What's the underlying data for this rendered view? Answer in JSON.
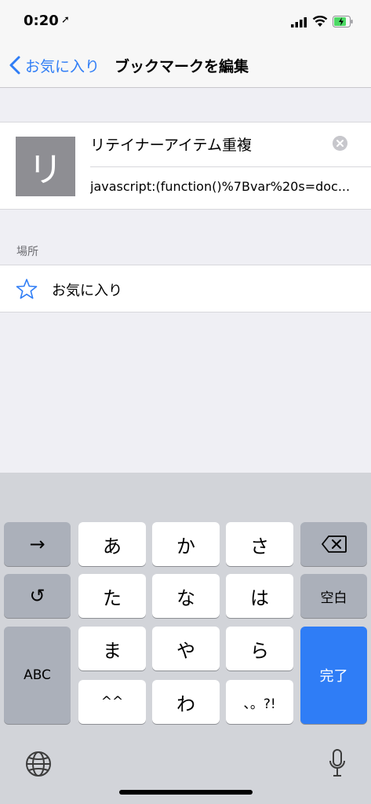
{
  "status": {
    "time": "0:20",
    "icons": [
      "location-arrow-icon",
      "signal-icon",
      "wifi-icon",
      "battery-charging-icon"
    ]
  },
  "nav": {
    "back_label": "お気に入り",
    "title": "ブックマークを編集"
  },
  "bookmark": {
    "thumb_letter": "リ",
    "title_value": "リテイナーアイテム重複",
    "url_value": "javascript:(function()%7Bvar%20s=doc..."
  },
  "location": {
    "section_label": "場所",
    "folder": "お気に入り"
  },
  "keyboard": {
    "keys": {
      "arrow": "→",
      "a": "あ",
      "ka": "か",
      "sa": "さ",
      "undo": "↺",
      "ta": "た",
      "na": "な",
      "ha": "は",
      "space": "空白",
      "abc": "ABC",
      "ma": "ま",
      "ya": "や",
      "ra": "ら",
      "done": "完了",
      "kaomoji": "^^",
      "wa": "わ",
      "punct": "、。?!"
    }
  },
  "colors": {
    "accent": "#2f7df6",
    "keyboard_bg": "#d2d4d9",
    "dark_key": "#abb0ba"
  }
}
